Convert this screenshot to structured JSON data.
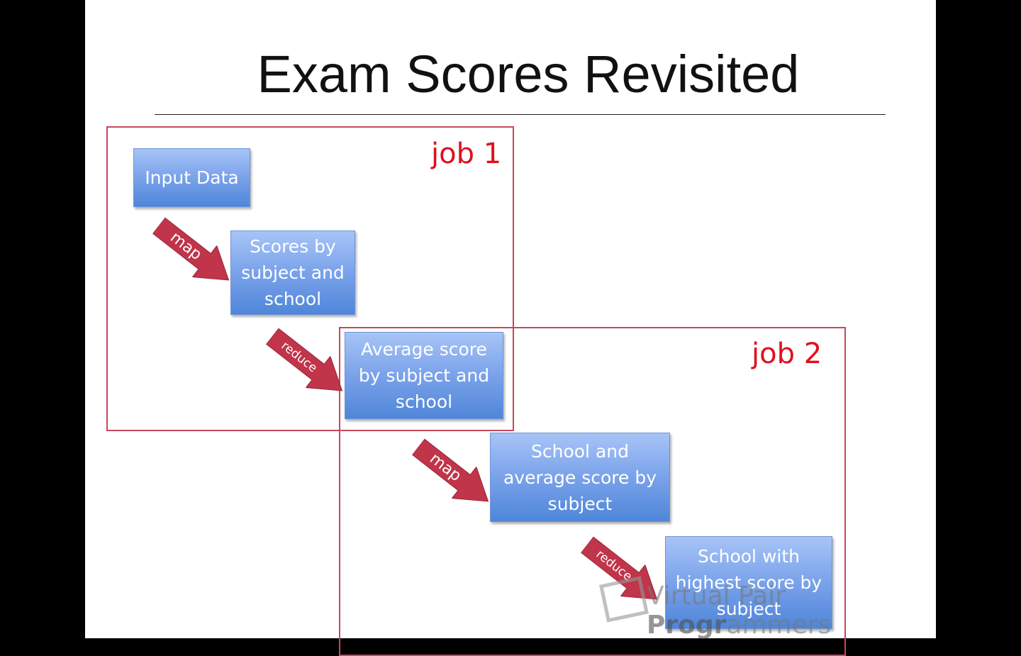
{
  "slide": {
    "title": "Exam Scores Revisited",
    "jobs": [
      {
        "label": "job 1"
      },
      {
        "label": "job 2"
      }
    ],
    "boxes": [
      {
        "label": "Input Data"
      },
      {
        "label": "Scores by\nsubject and\nschool"
      },
      {
        "label": "Average score\nby subject and\nschool"
      },
      {
        "label": "School and\naverage score by\nsubject"
      },
      {
        "label": "School with\nhighest score by\nsubject"
      }
    ],
    "arrows": [
      {
        "label": "map"
      },
      {
        "label": "reduce"
      },
      {
        "label": "map"
      },
      {
        "label": "reduce"
      }
    ],
    "watermark": {
      "light": "Virtual Pair ",
      "bold": "Progr",
      "rest": "ammers"
    }
  },
  "colors": {
    "box": "#7aa2ea",
    "arrow": "#c0354a",
    "job_border": "#c8475a",
    "job_label": "#e0101e"
  }
}
